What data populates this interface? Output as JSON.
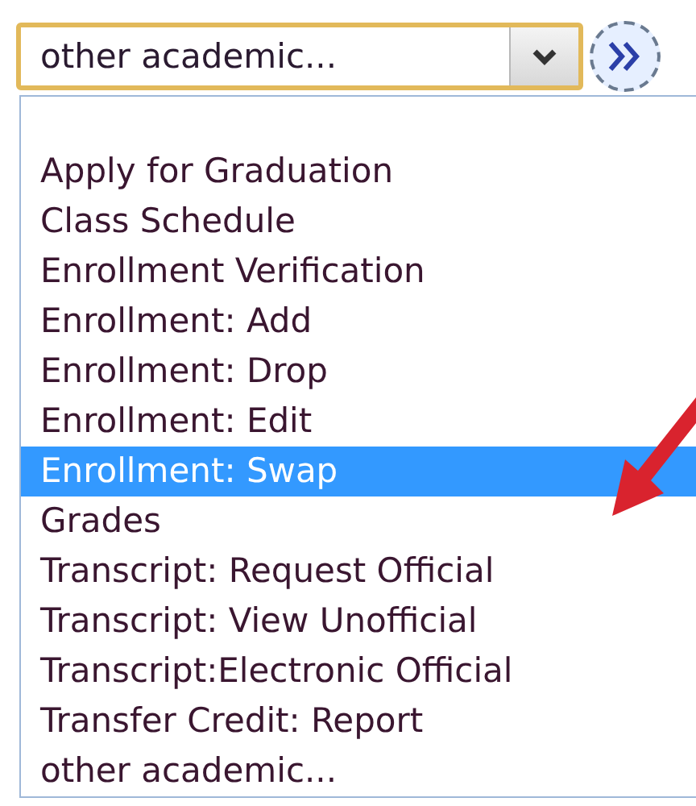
{
  "select": {
    "value": "other academic..."
  },
  "listbox": {
    "items": [
      {
        "label": "Apply for Graduation",
        "selected": false
      },
      {
        "label": "Class Schedule",
        "selected": false
      },
      {
        "label": "Enrollment Verification",
        "selected": false
      },
      {
        "label": "Enrollment: Add",
        "selected": false
      },
      {
        "label": "Enrollment: Drop",
        "selected": false
      },
      {
        "label": "Enrollment: Edit",
        "selected": false
      },
      {
        "label": "Enrollment: Swap",
        "selected": true
      },
      {
        "label": "Grades",
        "selected": false
      },
      {
        "label": "Transcript: Request Official",
        "selected": false
      },
      {
        "label": "Transcript: View Unofficial",
        "selected": false
      },
      {
        "label": "Transcript:Electronic Official",
        "selected": false
      },
      {
        "label": "Transfer Credit: Report",
        "selected": false
      },
      {
        "label": "other academic...",
        "selected": false
      }
    ]
  }
}
